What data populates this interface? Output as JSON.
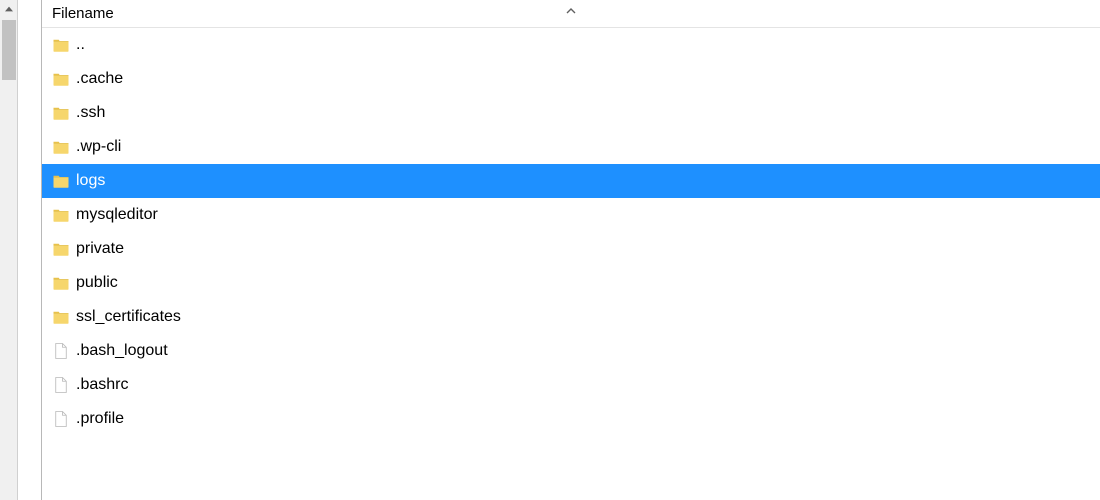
{
  "header": {
    "column_label": "Filename",
    "sort_direction": "asc"
  },
  "selection_color": "#1e90ff",
  "items": [
    {
      "name": "..",
      "type": "folder",
      "selected": false
    },
    {
      "name": ".cache",
      "type": "folder",
      "selected": false
    },
    {
      "name": ".ssh",
      "type": "folder",
      "selected": false
    },
    {
      "name": ".wp-cli",
      "type": "folder",
      "selected": false
    },
    {
      "name": "logs",
      "type": "folder",
      "selected": true
    },
    {
      "name": "mysqleditor",
      "type": "folder",
      "selected": false
    },
    {
      "name": "private",
      "type": "folder",
      "selected": false
    },
    {
      "name": "public",
      "type": "folder",
      "selected": false
    },
    {
      "name": "ssl_certificates",
      "type": "folder",
      "selected": false
    },
    {
      "name": ".bash_logout",
      "type": "file",
      "selected": false
    },
    {
      "name": ".bashrc",
      "type": "file",
      "selected": false
    },
    {
      "name": ".profile",
      "type": "file",
      "selected": false
    }
  ]
}
